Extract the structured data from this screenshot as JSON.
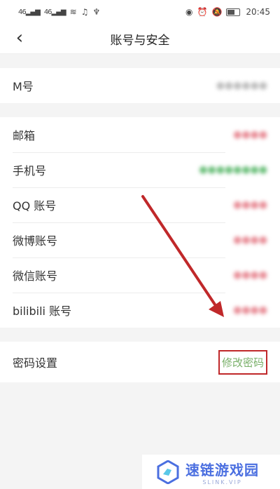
{
  "status_bar": {
    "signal1": "46",
    "signal2": "46",
    "time": "20:45"
  },
  "header": {
    "title": "账号与安全"
  },
  "group1": {
    "items": [
      {
        "label": "M号",
        "value": "●●●●●●"
      }
    ]
  },
  "group2": {
    "items": [
      {
        "label": "邮箱",
        "value": "●●●●"
      },
      {
        "label": "手机号",
        "value": "●●●●●●●●"
      },
      {
        "label": "QQ 账号",
        "value": "●●●●"
      },
      {
        "label": "微博账号",
        "value": "●●●●"
      },
      {
        "label": "微信账号",
        "value": "●●●●"
      },
      {
        "label": "bilibili 账号",
        "value": "●●●●"
      }
    ]
  },
  "group3": {
    "label": "密码设置",
    "action": "修改密码"
  },
  "colors": {
    "annotation": "#c0282a",
    "link": "#7ab06a"
  },
  "watermark": {
    "name": "速链游戏园",
    "sub": "SLINK.VIP"
  }
}
